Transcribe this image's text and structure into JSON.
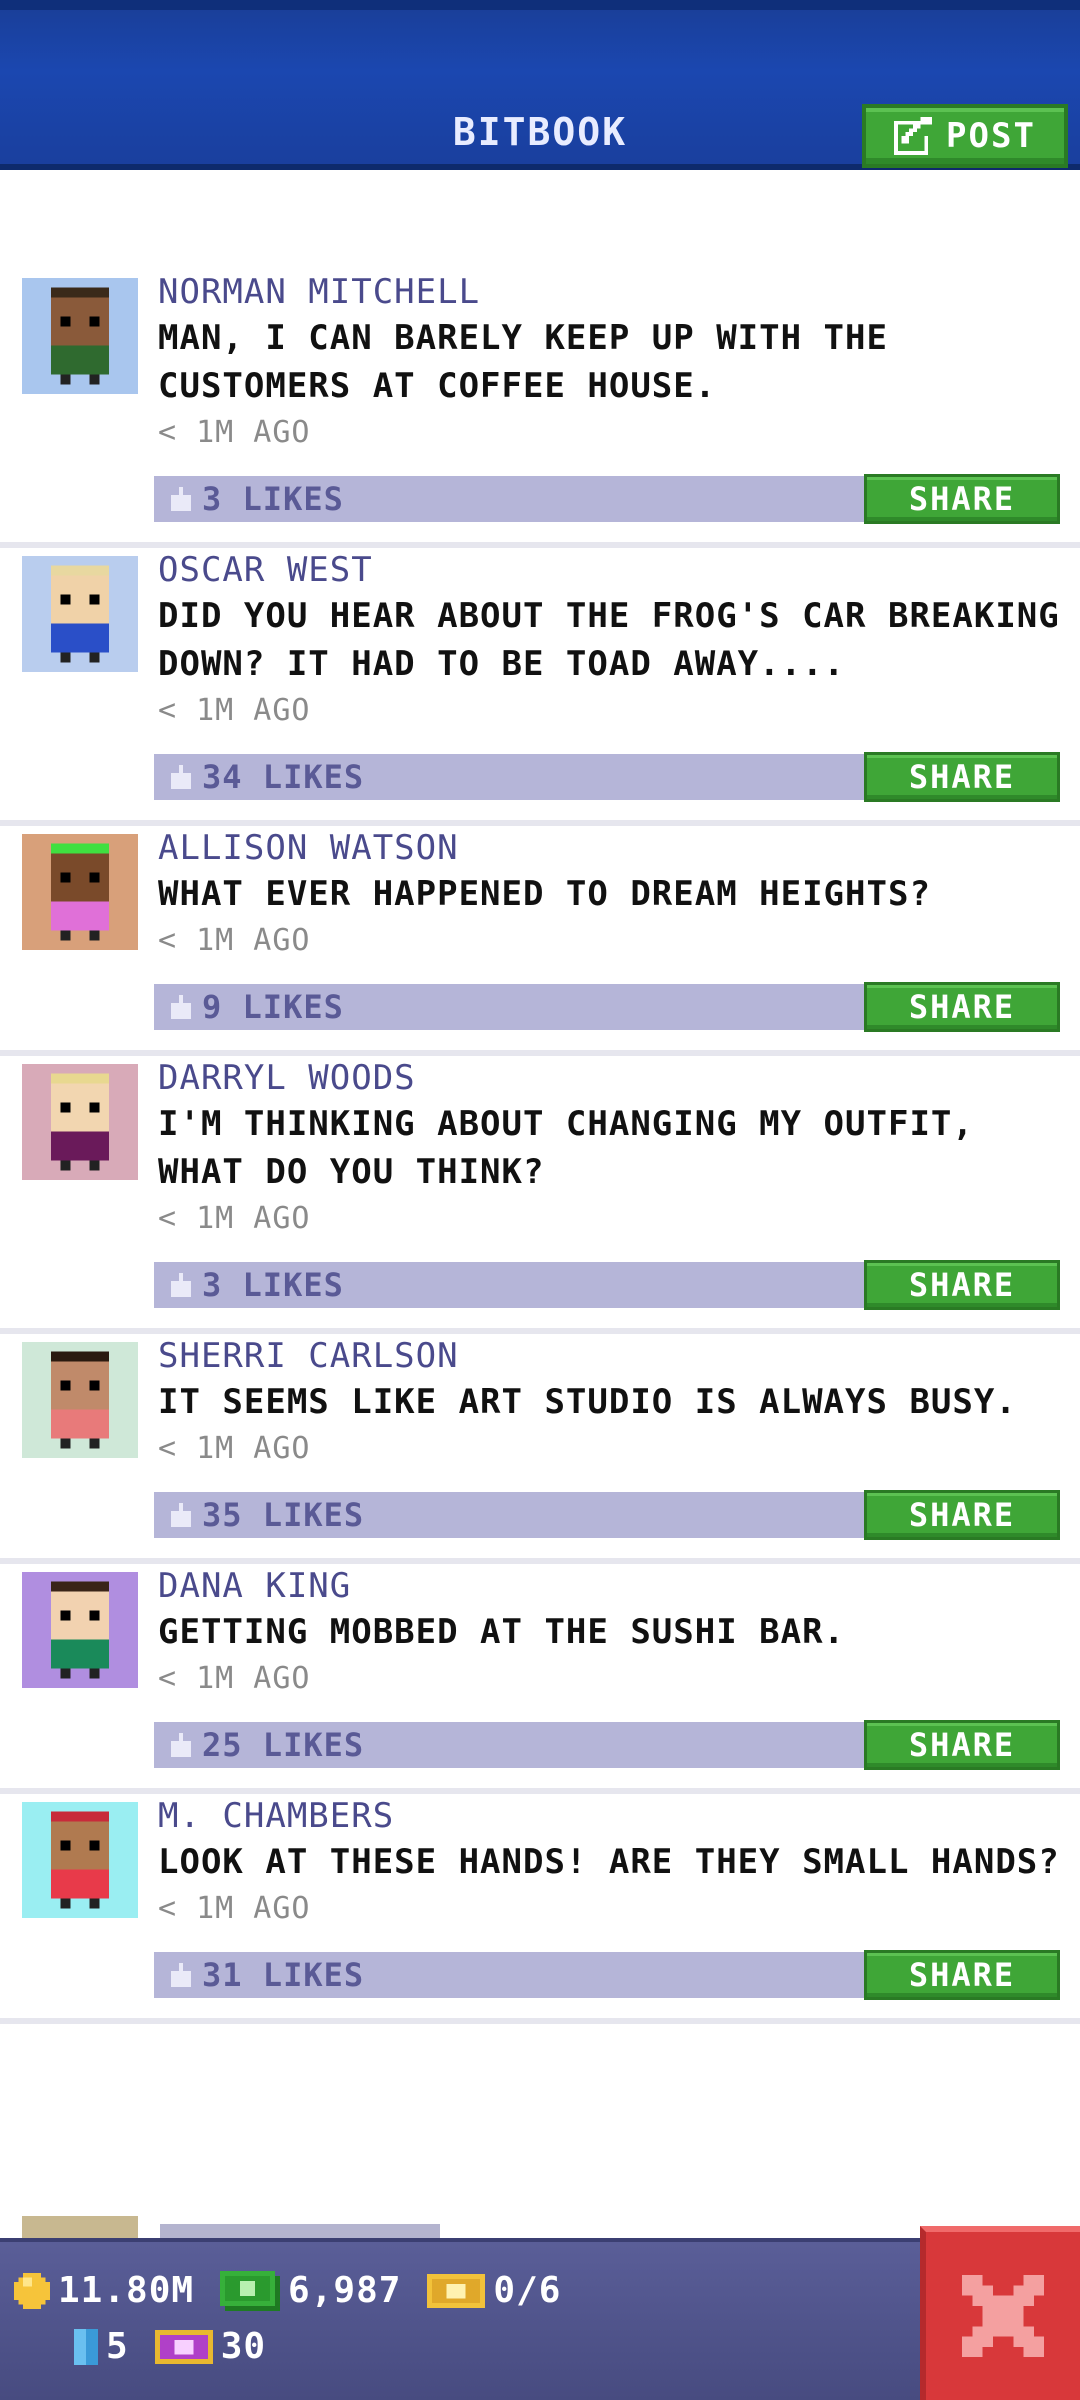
{
  "header": {
    "title": "BITBOOK",
    "post_label": "POST"
  },
  "posts": [
    {
      "author": "NORMAN MITCHELL",
      "message": "MAN, I CAN BARELY KEEP UP WITH THE CUSTOMERS AT COFFEE HOUSE.",
      "time": "< 1M AGO",
      "likes": "3 LIKES",
      "share": "SHARE",
      "avatar_bg": "#a9c6ee",
      "skin": "#8a5a3a",
      "shirt": "#2f6a2f",
      "hair": "#3a2a1a"
    },
    {
      "author": "OSCAR WEST",
      "message": "DID YOU HEAR ABOUT THE FROG'S CAR BREAKING DOWN? IT HAD TO BE TOAD AWAY....",
      "time": "< 1M AGO",
      "likes": "34 LIKES",
      "share": "SHARE",
      "avatar_bg": "#b9cdee",
      "skin": "#f0d2a8",
      "shirt": "#2a4fc8",
      "hair": "#e8d8a0"
    },
    {
      "author": "ALLISON WATSON",
      "message": "WHAT EVER HAPPENED TO DREAM HEIGHTS?",
      "time": "< 1M AGO",
      "likes": "9 LIKES",
      "share": "SHARE",
      "avatar_bg": "#d8a07a",
      "skin": "#7a4a2a",
      "shirt": "#e070d8",
      "hair": "#40e040"
    },
    {
      "author": "DARRYL WOODS",
      "message": "I'M THINKING ABOUT CHANGING MY OUTFIT, WHAT DO YOU THINK?",
      "time": "< 1M AGO",
      "likes": "3 LIKES",
      "share": "SHARE",
      "avatar_bg": "#d8aab8",
      "skin": "#f2d6b0",
      "shirt": "#6a1a5a",
      "hair": "#e8d890"
    },
    {
      "author": "SHERRI CARLSON",
      "message": "IT SEEMS LIKE ART STUDIO IS ALWAYS BUSY.",
      "time": "< 1M AGO",
      "likes": "35 LIKES",
      "share": "SHARE",
      "avatar_bg": "#cfe8d8",
      "skin": "#c08a6a",
      "shirt": "#e87a7a",
      "hair": "#2a1a10"
    },
    {
      "author": "DANA KING",
      "message": "GETTING MOBBED AT THE SUSHI BAR.",
      "time": "< 1M AGO",
      "likes": "25 LIKES",
      "share": "SHARE",
      "avatar_bg": "#b08ee0",
      "skin": "#f2d2b0",
      "shirt": "#1a8a5a",
      "hair": "#3a2418"
    },
    {
      "author": "M. CHAMBERS",
      "message": "LOOK AT THESE HANDS! ARE THEY SMALL HANDS?",
      "time": "< 1M AGO",
      "likes": "31 LIKES",
      "share": "SHARE",
      "avatar_bg": "#9aeef2",
      "skin": "#b07a50",
      "shirt": "#e83a4a",
      "hair": "#c82a3a"
    }
  ],
  "footer": {
    "coins": "11.80M",
    "bux": "6,987",
    "tickets": "0/6",
    "bitizens": "5",
    "vip": "30"
  },
  "colors": {
    "header_blue": "#1b47b0",
    "green_button": "#3fa637",
    "likes_bar": "#b5b5d8",
    "author": "#4a4a8c",
    "footer": "#4f5388",
    "close_red": "#d8383a"
  }
}
